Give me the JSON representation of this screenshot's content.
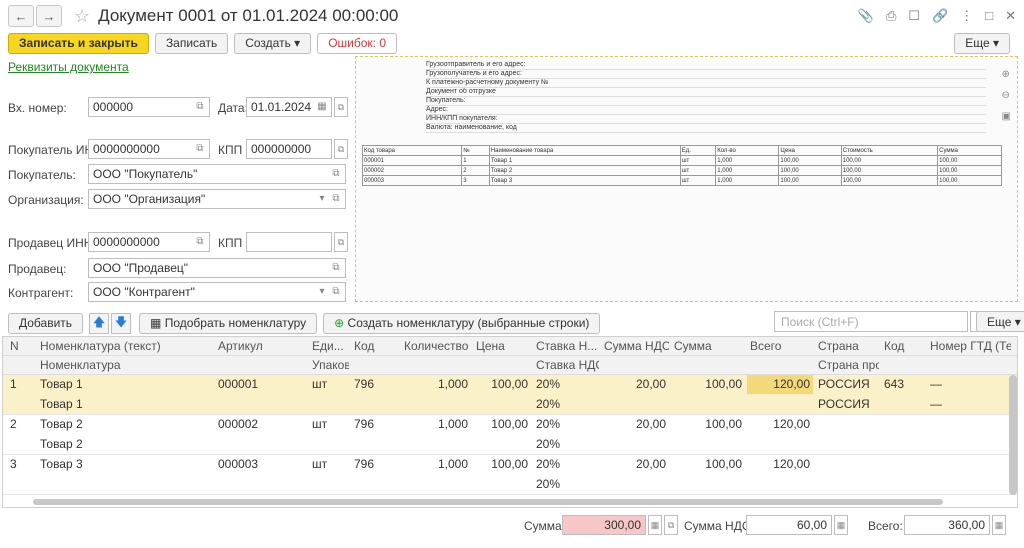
{
  "window": {
    "title": "Документ 0001 от 01.01.2024 00:00:00"
  },
  "toolbar": {
    "save_close": "Записать и закрыть",
    "save": "Записать",
    "create": "Создать",
    "errors": "Ошибок: 0",
    "more": "Еще"
  },
  "link": "Реквизиты документа",
  "fields": {
    "in_number_label": "Вх. номер:",
    "in_number": "000000",
    "date_label": "Дата:",
    "date": "01.01.2024",
    "buyer_inn_label": "Покупатель ИНН:",
    "buyer_inn": "0000000000",
    "kpp_label": "КПП :",
    "buyer_kpp": "000000000",
    "buyer_label": "Покупатель:",
    "buyer": "ООО \"Покупатель\"",
    "org_label": "Организация:",
    "org": "ООО \"Организация\"",
    "seller_inn_label": "Продавец ИНН:",
    "seller_inn": "0000000000",
    "seller_kpp_label": "КПП :",
    "seller_kpp": "",
    "seller_label": "Продавец:",
    "seller": "ООО \"Продавец\"",
    "contractor_label": "Контрагент:",
    "contractor": "ООО \"Контрагент\""
  },
  "preview": {
    "lines": [
      "Грузоотправитель и его адрес:",
      "Грузополучатель и его адрес:",
      "К платежно-расчетному документу №",
      "Документ об отгрузке",
      "Покупатель:",
      "Адрес:",
      "ИНН/КПП покупателя:",
      "Валюта: наименование, код"
    ],
    "table_header": [
      "Код товара",
      "№",
      "Наименование товара",
      "Ед.",
      "Кол-во",
      "Цена",
      "Стоимость",
      "Сумма"
    ],
    "table_rows": [
      [
        "000001",
        "1",
        "Товар 1",
        "шт",
        "1,000",
        "100,00",
        "100,00",
        "100,00"
      ],
      [
        "000002",
        "2",
        "Товар 2",
        "шт",
        "1,000",
        "100,00",
        "100,00",
        "100,00"
      ],
      [
        "000003",
        "3",
        "Товар 3",
        "шт",
        "1,000",
        "100,00",
        "100,00",
        "100,00"
      ]
    ]
  },
  "table_toolbar": {
    "add": "Добавить",
    "pick": "Подобрать номенклатуру",
    "create_nom": "Создать номенклатуру (выбранные строки)",
    "search_placeholder": "Поиск (Ctrl+F)",
    "more": "Еще"
  },
  "columns": {
    "n": "N",
    "nom": "Номенклатура (текст)",
    "art": "Артикул",
    "unit": "Еди...",
    "code": "Код",
    "qty": "Количество",
    "price": "Цена",
    "vat_rate": "Ставка Н...",
    "vat_sum": "Сумма НДС",
    "sum": "Сумма",
    "total": "Всего",
    "country": "Страна",
    "ccode": "Код",
    "gtd": "Номер ГТД (Текст)",
    "nom2": "Номенклатура",
    "pack": "Упаковка",
    "vat_rate2": "Ставка НДС",
    "country2": "Страна происхожде..."
  },
  "rows": [
    {
      "n": "1",
      "nom": "Товар 1",
      "art": "000001",
      "unit": "шт",
      "code": "796",
      "qty": "1,000",
      "price": "100,00",
      "vat": "20%",
      "vat_sum": "20,00",
      "sum": "100,00",
      "total": "120,00",
      "country": "РОССИЯ",
      "ccode": "643",
      "gtd": "—",
      "nom2": "Товар 1",
      "vat2": "20%",
      "country2": "РОССИЯ",
      "gtd2": "—"
    },
    {
      "n": "2",
      "nom": "Товар 2",
      "art": "000002",
      "unit": "шт",
      "code": "796",
      "qty": "1,000",
      "price": "100,00",
      "vat": "20%",
      "vat_sum": "20,00",
      "sum": "100,00",
      "total": "120,00",
      "country": "",
      "ccode": "",
      "gtd": "",
      "nom2": "Товар 2",
      "vat2": "20%",
      "country2": "",
      "gtd2": ""
    },
    {
      "n": "3",
      "nom": "Товар 3",
      "art": "000003",
      "unit": "шт",
      "code": "796",
      "qty": "1,000",
      "price": "100,00",
      "vat": "20%",
      "vat_sum": "20,00",
      "sum": "100,00",
      "total": "120,00",
      "country": "",
      "ccode": "",
      "gtd": "",
      "nom2": "",
      "vat2": "20%",
      "country2": "",
      "gtd2": ""
    }
  ],
  "footer": {
    "sum_label": "Сумма:",
    "sum": "300,00",
    "vat_label": "Сумма НДС:",
    "vat": "60,00",
    "total_label": "Всего:",
    "total": "360,00"
  }
}
